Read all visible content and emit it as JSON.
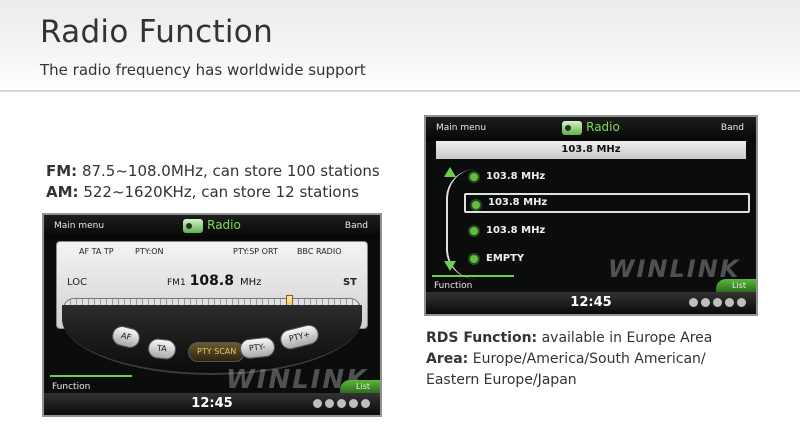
{
  "header": {
    "title": "Radio Function",
    "subtitle": "The radio frequency has worldwide support"
  },
  "specs": {
    "fm_label": "FM:",
    "fm_text": " 87.5~108.0MHz, can store 100 stations",
    "am_label": "AM:",
    "am_text": " 522~1620KHz, can store 12 stations"
  },
  "rds": {
    "rds_label": "RDS Function:",
    "rds_text": " available in Europe Area",
    "area_label": "Area:",
    "area_text": " Europe/America/South American/",
    "area_text2": "Eastern Europe/Japan"
  },
  "screen1": {
    "main_menu": "Main menu",
    "title": "Radio",
    "band": "Band",
    "info": [
      "AF TA TP",
      "PTY:ON",
      "PTY:SP ORT",
      "BBC RADIO"
    ],
    "loc": "LOC",
    "band_label": "FM1",
    "frequency": "108.8",
    "unit": "MHz",
    "stereo": "ST",
    "buttons": [
      "AF",
      "TA",
      "PTY SCAN",
      "PTY-",
      "PTY+"
    ],
    "function": "Function",
    "list": "List",
    "clock": "12:45",
    "watermark": "WINLINK"
  },
  "screen2": {
    "main_menu": "Main menu",
    "title": "Radio",
    "band": "Band",
    "current": "103.8 MHz",
    "stations": [
      "103.8 MHz",
      "103.8 MHz",
      "103.8 MHz",
      "EMPTY"
    ],
    "function": "Function",
    "list": "List",
    "clock": "12:45",
    "watermark": "WINLINK"
  },
  "colors": {
    "accent_green": "#6ed04a",
    "screen_bg": "#0b0d0c"
  }
}
